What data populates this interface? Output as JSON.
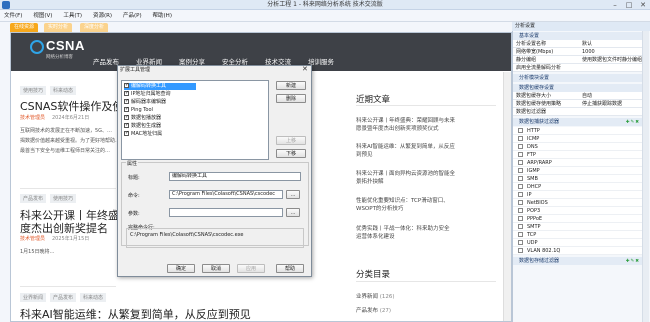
{
  "window": {
    "title": "分析工程 1 - 科来网络分析系统 技术交流版",
    "minimize": "–",
    "maximize": "□",
    "close": "✕"
  },
  "menu": [
    "文件(F)",
    "视图(V)",
    "工具(T)",
    "资源(R)",
    "产品(P)",
    "帮助(H)"
  ],
  "tabs": [
    "在线资源",
    "实时分析",
    "深度分析"
  ],
  "site": {
    "logo_text": "CSNA",
    "logo_sub": "网络分析博客",
    "nav": [
      "产品发布",
      "业界新闻",
      "案例分享",
      "安全分析",
      "技术交流",
      "培训服务"
    ]
  },
  "articles": [
    {
      "tags": [
        "使用技巧",
        "科来动态"
      ],
      "title": "CSNAS软件操作及使用",
      "author": "技术管理员",
      "date": "2024年6月21日",
      "body": [
        "互联网技术的发展正在不断加速，5G、…",
        "揭数据价值越来越受重视。为了更好地帮助…",
        "最首当下安全与运维工程师日常关注的…"
      ]
    },
    {
      "tags": [
        "产品发布",
        "使用技巧"
      ],
      "title_lines": [
        "科来公开课丨年终盛典",
        "度杰出创新奖提名"
      ],
      "author": "技术管理员",
      "date": "2025年1月15日",
      "body": [
        "1月15日晚将…"
      ]
    },
    {
      "tags": [
        "业界新闻",
        "产品发布",
        "科来动态"
      ],
      "title": "科来AI智能运维：从繁复到简单，从反应到预见"
    }
  ],
  "recent": {
    "title": "近期文章",
    "items": [
      [
        "科来公开课丨年终盛典：荣耀回顾与未来",
        "愿景暨年度杰出创新奖项颁奖仪式"
      ],
      [
        "科来AI智能运维：从繁复到简单，从反应",
        "到预见"
      ],
      [
        "科来公开课丨面向异构云资源池的智能全",
        "景拓扑抉解"
      ],
      [
        "性能优化重要知识点：TCP滑动窗口、",
        "WSOPT的分析技巧"
      ],
      [
        "优秀实践丨平战一体化：科来助力安全",
        "运营体系化建设"
      ]
    ]
  },
  "categories": {
    "title": "分类目录",
    "items": [
      {
        "name": "业界新闻",
        "count": "(126)"
      },
      {
        "name": "产品发布",
        "count": "(27)"
      }
    ]
  },
  "dialog": {
    "title": "扩展工具管理",
    "tools": [
      {
        "label": "编解码转换工具",
        "checked": true
      },
      {
        "label": "IP地址归属地查询",
        "checked": true
      },
      {
        "label": "解码器本编辑器",
        "checked": true
      },
      {
        "label": "Ping Tool",
        "checked": true
      },
      {
        "label": "数据包播放器",
        "checked": true
      },
      {
        "label": "数据包生成器",
        "checked": true
      },
      {
        "label": "MAC地址归属",
        "checked": true
      }
    ],
    "btn_new": "新建",
    "btn_delete": "删除",
    "btn_up": "上移",
    "btn_down": "下移",
    "group_attr": "属性",
    "label_title": "标题:",
    "value_title": "编解码转换工具",
    "label_cmd": "命令:",
    "value_cmd": "C:\\Program Files\\Colasoft\\CSNAS\\cscodec",
    "label_args": "参数:",
    "value_args": "",
    "label_full": "完整命令行:",
    "value_full": "C:\\Program Files\\Colasoft\\CSNAS\\cscodec.exe",
    "browse": "...",
    "btn_ok": "确定",
    "btn_cancel": "取消",
    "btn_apply": "应用",
    "btn_help": "帮助",
    "close": "✕"
  },
  "settings_panel": {
    "title": "分析设置",
    "sections": {
      "basic": "基本设置",
      "modules": "分析模块设置",
      "storage": "数据包缓存设置",
      "filter": "数据包捕获过滤器",
      "save": "数据包存储过滤器"
    },
    "basic_rows": [
      {
        "key": "分析设置名称",
        "val": "默认"
      },
      {
        "key": "网络带宽(Mbps)",
        "val": "1000"
      },
      {
        "key": "静分编组",
        "val": "使用数据包文件时静分编组"
      },
      {
        "key": "启用全流量解码分析",
        "val": ""
      }
    ],
    "storage_rows": [
      {
        "key": "数据包缓存大小",
        "val": "自动"
      },
      {
        "key": "数据包缓存使用策略",
        "val": "停止捕获跟踪数据"
      },
      {
        "key": "数据包过滤器",
        "val": ""
      }
    ],
    "protocols": [
      "HTTP",
      "ICMP",
      "DNS",
      "FTP",
      "ARP/RARP",
      "IGMP",
      "SMB",
      "DHCP",
      "IP",
      "NetBIOS",
      "POP3",
      "PPPoE",
      "SMTP",
      "TCP",
      "UDP",
      "VLAN 802.1Q"
    ],
    "icons_label": "✚✎✖"
  }
}
